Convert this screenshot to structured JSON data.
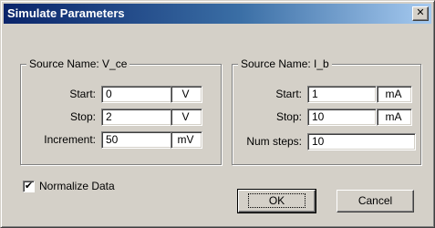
{
  "window": {
    "title": "Simulate Parameters",
    "close_glyph": "✕"
  },
  "groups": [
    {
      "legend": "Source Name: V_ce",
      "fields": [
        {
          "label": "Start:",
          "value": "0",
          "unit": "V"
        },
        {
          "label": "Stop:",
          "value": "2",
          "unit": "V"
        },
        {
          "label": "Increment:",
          "value": "50",
          "unit": "mV"
        }
      ]
    },
    {
      "legend": "Source Name: I_b",
      "fields": [
        {
          "label": "Start:",
          "value": "1",
          "unit": "mA"
        },
        {
          "label": "Stop:",
          "value": "10",
          "unit": "mA"
        },
        {
          "label": "Num steps:",
          "value": "10"
        }
      ]
    }
  ],
  "normalize": {
    "label": "Normalize Data",
    "checked": true,
    "mark": "✔"
  },
  "buttons": {
    "ok": "OK",
    "cancel": "Cancel"
  }
}
